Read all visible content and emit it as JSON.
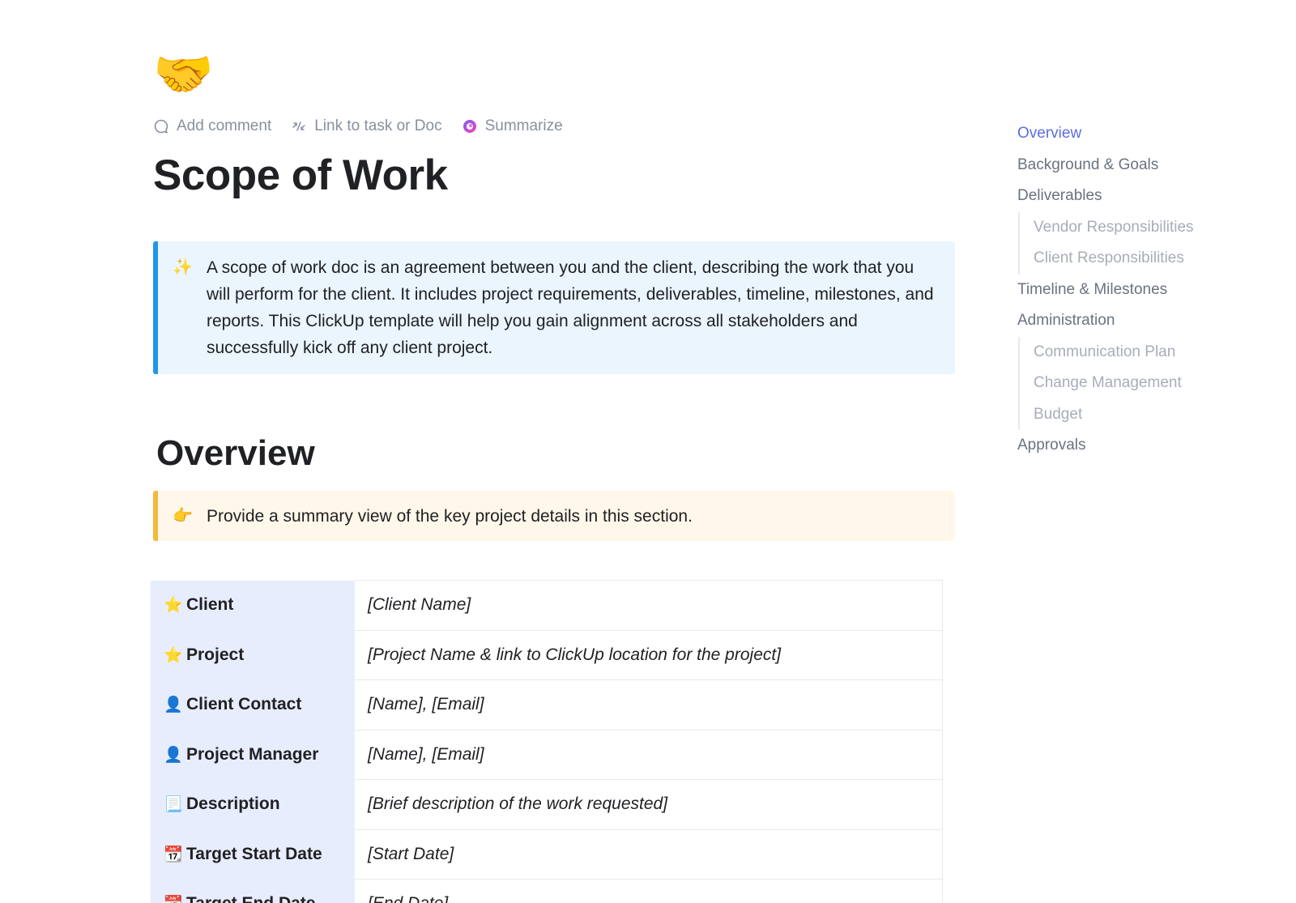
{
  "page": {
    "icon_emoji": "🤝",
    "title": "Scope of Work"
  },
  "actions": {
    "add_comment": "Add comment",
    "link_task": "Link to task or Doc",
    "summarize": "Summarize"
  },
  "intro_callout": {
    "emoji": "✨",
    "text": "A scope of work doc is an agreement between you and the client, describing the work that you will perform for the client. It includes project requirements, deliverables, timeline, milestones, and reports. This ClickUp template will help you gain alignment across all stakeholders and successfully kick off any client project."
  },
  "overview": {
    "heading": "Overview",
    "callout_emoji": "👉",
    "callout_text": "Provide a summary view of the key project details in this section."
  },
  "table": {
    "rows": [
      {
        "emoji": "⭐",
        "label": "Client",
        "value": "[Client Name]"
      },
      {
        "emoji": "⭐",
        "label": "Project",
        "value": "[Project Name & link to ClickUp location for the project]"
      },
      {
        "emoji": "👤",
        "label": "Client Contact",
        "value": "[Name], [Email]"
      },
      {
        "emoji": "👤",
        "label": "Project Manager",
        "value": "[Name], [Email]"
      },
      {
        "emoji": "📃",
        "label": "Description",
        "value": "[Brief description of the work requested]"
      },
      {
        "emoji": "📆",
        "label": "Target Start Date",
        "value": "[Start Date]"
      },
      {
        "emoji": "📆",
        "label": "Target End Date",
        "value": "[End Date]"
      }
    ]
  },
  "toc": {
    "overview": "Overview",
    "background": "Background & Goals",
    "deliverables": "Deliverables",
    "vendor": "Vendor Responsibilities",
    "client": "Client Responsibilities",
    "timeline": "Timeline & Milestones",
    "administration": "Administration",
    "communication": "Communication Plan",
    "change": "Change Management",
    "budget": "Budget",
    "approvals": "Approvals"
  },
  "colors": {
    "toc_active": "#5b6ee1",
    "blue_callout_border": "#2196e8",
    "yellow_callout_border": "#f5b83d",
    "table_key_bg": "#e8edfd"
  }
}
